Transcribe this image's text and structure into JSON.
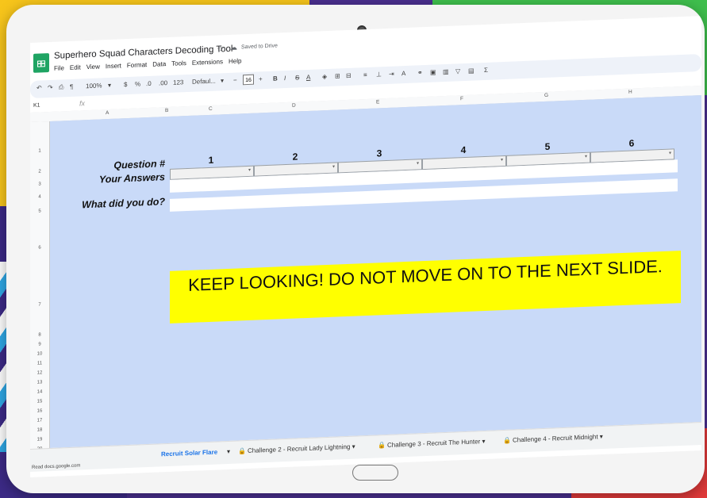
{
  "app": {
    "doc_title": "Superhero Squad Characters Decoding Tool",
    "saved_status": "Saved to Drive",
    "menu": [
      "File",
      "Edit",
      "View",
      "Insert",
      "Format",
      "Data",
      "Tools",
      "Extensions",
      "Help"
    ]
  },
  "toolbar": {
    "zoom": "100%",
    "currency": "$",
    "percent": "%",
    "dec_decrease": ".0",
    "dec_increase": ".00",
    "number_format": "123",
    "font": "Defaul...",
    "font_size": "16",
    "bold": "B",
    "italic": "I",
    "strike": "S",
    "text_color": "A",
    "sum": "Σ"
  },
  "formula_bar": {
    "cell_ref": "K1",
    "fx": "fx"
  },
  "columns": [
    "A",
    "B",
    "C",
    "D",
    "E",
    "F",
    "G",
    "H"
  ],
  "rows": [
    "1",
    "2",
    "3",
    "4",
    "5",
    "6",
    "7",
    "8",
    "9",
    "10",
    "11",
    "12",
    "13",
    "14",
    "15",
    "16",
    "17",
    "18",
    "19",
    "20"
  ],
  "sheet": {
    "question_label": "Question #",
    "answers_label": "Your Answers",
    "what_label": "What did you do?",
    "question_numbers": [
      "1",
      "2",
      "3",
      "4",
      "5",
      "6"
    ],
    "banner": "KEEP LOOKING! DO NOT MOVE ON TO THE NEXT SLIDE."
  },
  "tabs": {
    "active": "Recruit Solar Flare",
    "items": [
      "Challenge 2 - Recruit Lady Lightning",
      "Challenge 3 - Recruit The Hunter",
      "Challenge 4 - Recruit Midnight"
    ]
  },
  "status_text": "Read docs.google.com"
}
